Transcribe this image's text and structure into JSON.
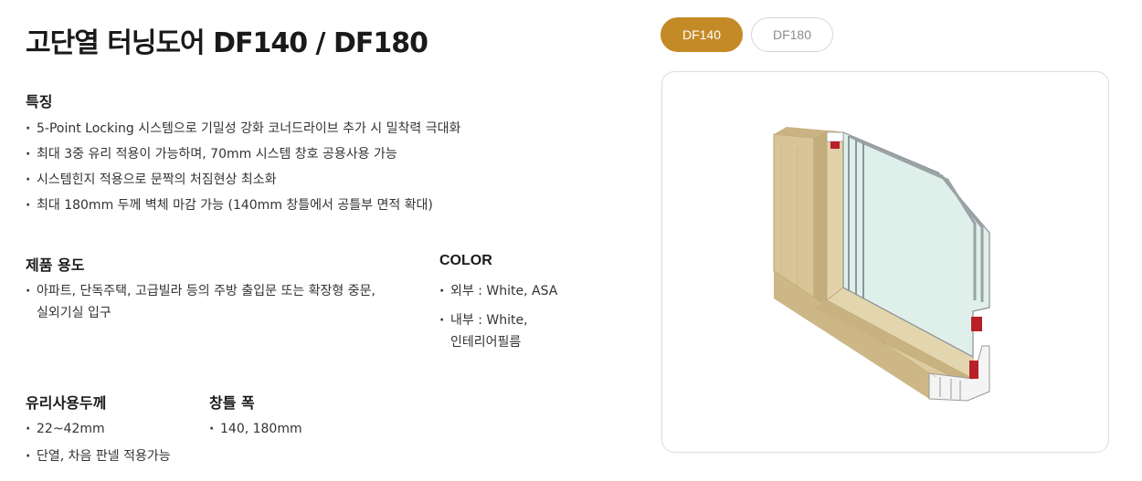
{
  "page": {
    "title": "고단열 터닝도어 DF140 / DF180"
  },
  "tabs": [
    {
      "label": "DF140",
      "active": true
    },
    {
      "label": "DF180",
      "active": false
    }
  ],
  "features": {
    "heading": "특징",
    "items": [
      "5-Point Locking 시스템으로 기밀성 강화 코너드라이브 추가 시 밀착력 극대화",
      "최대 3중 유리 적용이 가능하며, 70mm 시스템 창호 공용사용 가능",
      "시스템힌지 적용으로 문짝의 처짐현상 최소화",
      "최대 180mm 두께 벽체 마감 가능 (140mm 창틀에서 공틀부 면적 확대)"
    ]
  },
  "usage": {
    "heading": "제품 용도",
    "line1": "아파트, 단독주택, 고급빌라 등의 주방 출입문 또는 확장형 중문,",
    "line2": "실외기실 입구"
  },
  "color": {
    "heading": "COLOR",
    "outer": "외부 : White, ASA",
    "inner_line1": "내부 : White,",
    "inner_line2": "인테리어필름"
  },
  "glass": {
    "heading": "유리사용두께",
    "items": [
      "22~42mm",
      "단열, 차음 판넬 적용가능"
    ]
  },
  "frame": {
    "heading": "창틀 폭",
    "items": [
      "140, 180mm"
    ]
  },
  "colors": {
    "accent": "#c48a26",
    "wood": "#d9c69c",
    "glass": "#dff0ea",
    "frame_red": "#b8202a"
  },
  "image": {
    "icon": "door-frame-cross-section-illustration"
  }
}
